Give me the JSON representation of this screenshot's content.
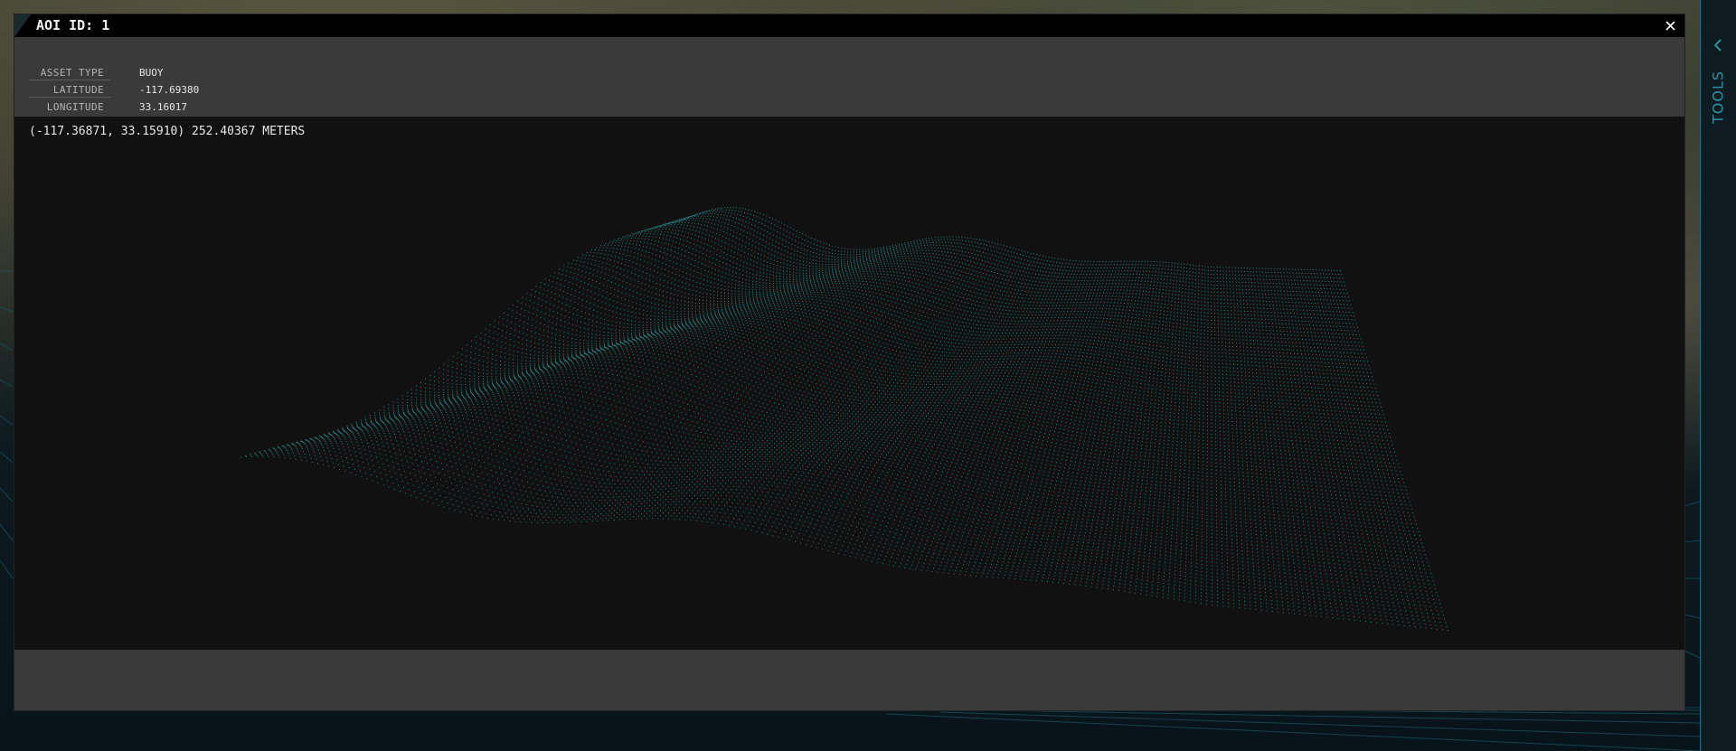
{
  "modal": {
    "title": "AOI ID: 1",
    "close_icon": "close-icon"
  },
  "info": [
    {
      "key": "ASSET TYPE",
      "value": "BUOY"
    },
    {
      "key": "LATITUDE",
      "value": "-117.69380"
    },
    {
      "key": "LONGITUDE",
      "value": "33.16017"
    }
  ],
  "viewport": {
    "readout": "(-117.36871, 33.15910) 252.40367 METERS",
    "point_color": "#2fb8b8"
  },
  "sidebar": {
    "tools_label": "TOOLS",
    "chevron_icon": "chevron-left-icon"
  },
  "colors": {
    "accent": "#2e8fa2",
    "panel": "#3a3a3a",
    "viewport_bg": "#111111"
  }
}
